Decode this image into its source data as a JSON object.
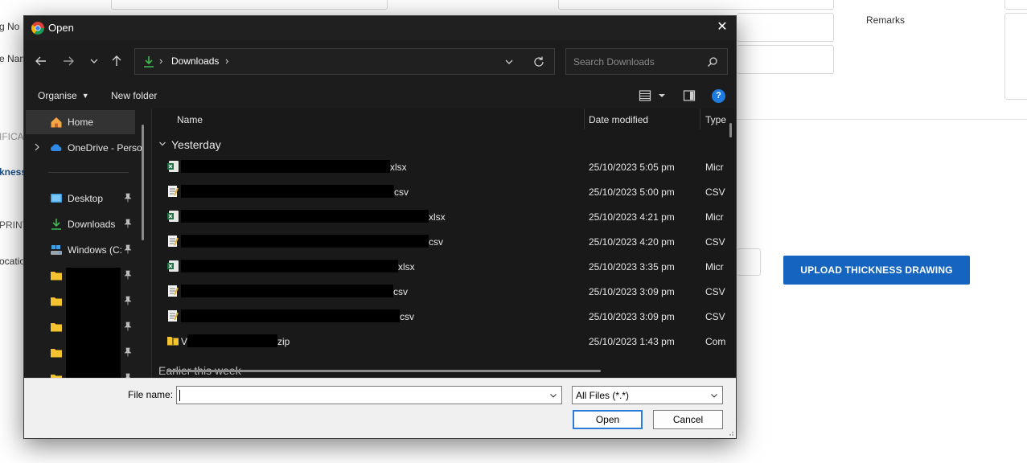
{
  "background_page": {
    "fragments": [
      "g No",
      "e Nam",
      "IFICA",
      "kness",
      "PRINT",
      "ocatio"
    ],
    "remarks_label": "Remarks",
    "upload_button_label": "UPLOAD THICKNESS DRAWING"
  },
  "dialog": {
    "title": "Open",
    "close_glyph": "✕",
    "address": {
      "crumb": "Downloads",
      "separator": "›"
    },
    "search_placeholder": "Search Downloads",
    "toolbar": {
      "organise_label": "Organise",
      "new_folder_label": "New folder",
      "help_glyph": "?"
    },
    "nav": {
      "home": "Home",
      "onedrive": "OneDrive - Perso",
      "desktop": "Desktop",
      "downloads": "Downloads",
      "windows": "Windows (C:"
    },
    "columns": {
      "name": "Name",
      "date": "Date modified",
      "type": "Type"
    },
    "group_yesterday": "Yesterday",
    "group_earlier": "Earlier this week",
    "files": [
      {
        "name_suffix": "xlsx",
        "date": "25/10/2023 5:05 pm",
        "type": "Micr",
        "icon": "excel-file-icon"
      },
      {
        "name_suffix": "csv",
        "date": "25/10/2023 5:00 pm",
        "type": "CSV",
        "icon": "csv-file-icon"
      },
      {
        "name_suffix": "xlsx",
        "date": "25/10/2023 4:21 pm",
        "type": "Micr",
        "icon": "excel-file-icon"
      },
      {
        "name_suffix": "csv",
        "date": "25/10/2023 4:20 pm",
        "type": "CSV",
        "icon": "csv-file-icon"
      },
      {
        "name_suffix": "xlsx",
        "date": "25/10/2023 3:35 pm",
        "type": "Micr",
        "icon": "excel-file-icon"
      },
      {
        "name_suffix": "csv",
        "date": "25/10/2023 3:09 pm",
        "type": "CSV",
        "icon": "csv-file-icon"
      },
      {
        "name_suffix": "csv",
        "date": "25/10/2023 3:09 pm",
        "type": "CSV",
        "icon": "csv-file-icon"
      },
      {
        "name_prefix": "V",
        "name_suffix": "zip",
        "date": "25/10/2023 1:43 pm",
        "type": "Com",
        "icon": "zip-folder-icon"
      }
    ],
    "footer": {
      "file_name_label": "File name:",
      "file_name_value": "",
      "filter_value": "All Files (*.*)",
      "open_label": "Open",
      "cancel_label": "Cancel"
    }
  },
  "colors": {
    "accent": "#1565c0",
    "dialog_bg": "#1c1c1c",
    "folder_yellow": "#f4c430",
    "excel_green": "#1d6f42",
    "help_blue": "#1f7be0"
  }
}
